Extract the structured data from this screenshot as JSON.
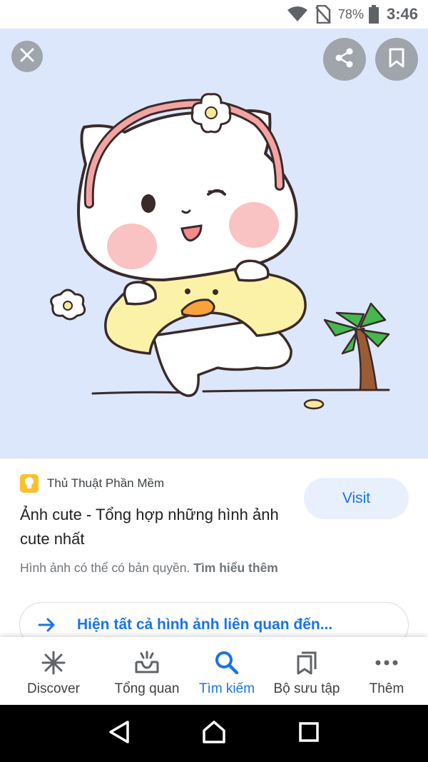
{
  "status_bar": {
    "battery_percent": "78%",
    "time": "3:46",
    "icons": [
      "wifi-icon",
      "no-sim-icon",
      "battery-icon"
    ]
  },
  "viewer": {
    "close_icon": "close-icon",
    "share_icon": "share-icon",
    "save_icon": "bookmark-icon",
    "background_color": "#dde7fb"
  },
  "result": {
    "source_name": "Thủ Thuật Phần Mềm",
    "source_icon": "lightbulb-icon",
    "title": "Ảnh cute - Tổng hợp những hình ảnh cute nhất",
    "visit_label": "Visit",
    "copyright_text": "Hình ảnh có thể có bản quyền.",
    "learn_more": "Tìm hiểu thêm",
    "related_label": "Hiện tất cả hình ảnh liên quan đến..."
  },
  "bottom_nav": {
    "items": [
      {
        "label": "Discover",
        "icon": "asterisk-icon"
      },
      {
        "label": "Tổng quan",
        "icon": "inbox-tray-icon"
      },
      {
        "label": "Tìm kiếm",
        "icon": "search-icon",
        "active": true
      },
      {
        "label": "Bộ sưu tập",
        "icon": "collections-icon"
      },
      {
        "label": "Thêm",
        "icon": "more-horiz-icon"
      }
    ]
  },
  "colors": {
    "accent": "#1a73e8",
    "visit_bg": "#e8f0fe",
    "source_icon_bg": "#fbc02d"
  }
}
